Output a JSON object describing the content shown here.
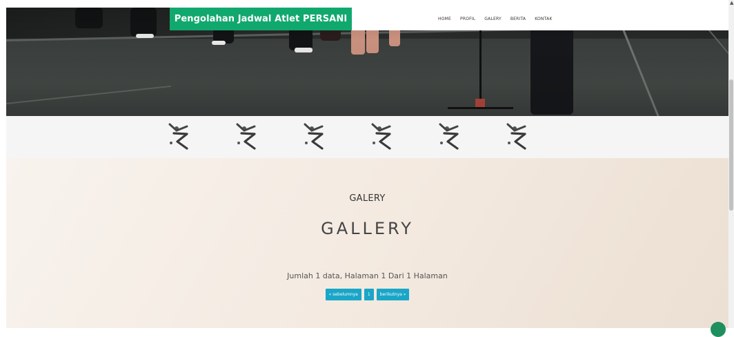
{
  "navbar": {
    "brand": "Pengolahan Jadwal Atlet PERSANI",
    "menu": [
      "HOME",
      "PROFIL",
      "GALERY",
      "BERITA",
      "KONTAK"
    ]
  },
  "logos": {
    "count": 6,
    "icon": "gymnast-logo-icon"
  },
  "section": {
    "breadcrumb": "GALERY",
    "title": "GALLERY",
    "info": "Jumlah 1 data, Halaman 1 Dari 1 Halaman"
  },
  "pagination": {
    "prev": "« sebelumnya",
    "page": "1",
    "next": "berikutnya »"
  },
  "colors": {
    "brand": "#11a86e",
    "pager": "#1aa6c8"
  }
}
